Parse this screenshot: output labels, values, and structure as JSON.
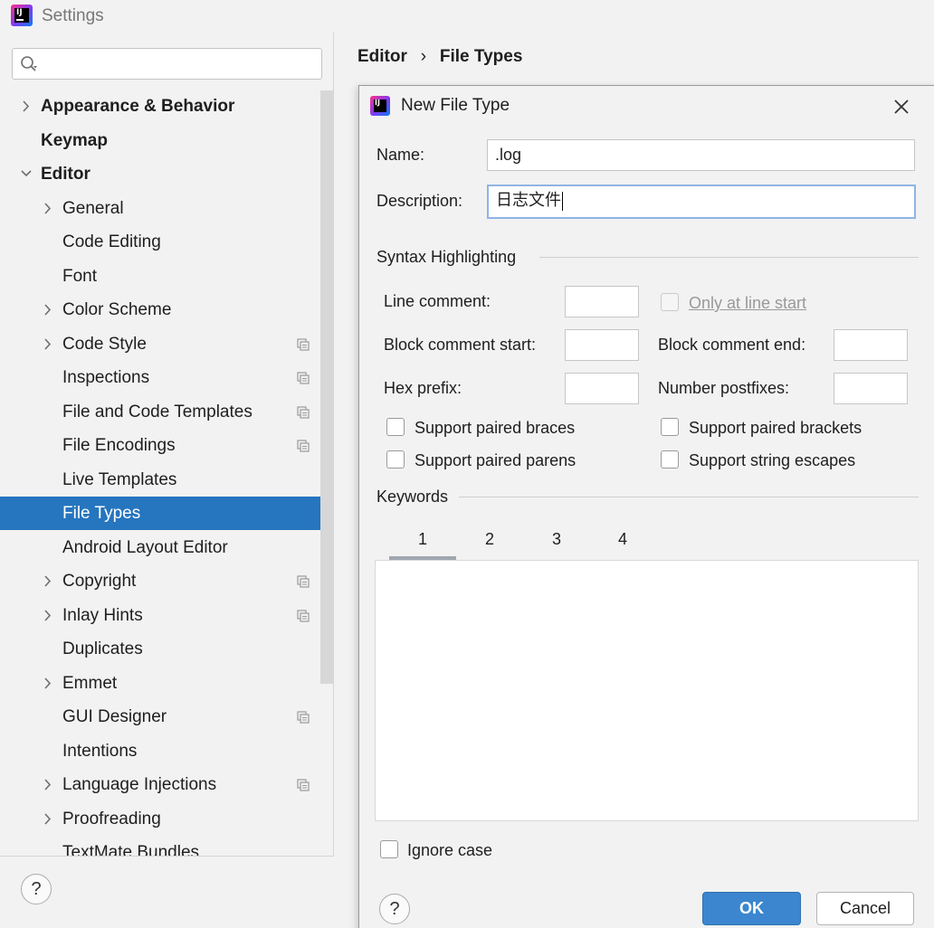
{
  "window": {
    "title": "Settings"
  },
  "search": {
    "placeholder": "",
    "value": ""
  },
  "tree": [
    {
      "label": "Appearance & Behavior",
      "level": 0,
      "bold": true,
      "arrow": "collapsed",
      "project": false
    },
    {
      "label": "Keymap",
      "level": 0,
      "bold": true,
      "arrow": "none",
      "project": false
    },
    {
      "label": "Editor",
      "level": 0,
      "bold": true,
      "arrow": "expanded",
      "project": false
    },
    {
      "label": "General",
      "level": 1,
      "bold": false,
      "arrow": "collapsed",
      "project": false
    },
    {
      "label": "Code Editing",
      "level": 1,
      "bold": false,
      "arrow": "none",
      "project": false
    },
    {
      "label": "Font",
      "level": 1,
      "bold": false,
      "arrow": "none",
      "project": false
    },
    {
      "label": "Color Scheme",
      "level": 1,
      "bold": false,
      "arrow": "collapsed",
      "project": false
    },
    {
      "label": "Code Style",
      "level": 1,
      "bold": false,
      "arrow": "collapsed",
      "project": true
    },
    {
      "label": "Inspections",
      "level": 1,
      "bold": false,
      "arrow": "none",
      "project": true
    },
    {
      "label": "File and Code Templates",
      "level": 1,
      "bold": false,
      "arrow": "none",
      "project": true
    },
    {
      "label": "File Encodings",
      "level": 1,
      "bold": false,
      "arrow": "none",
      "project": true
    },
    {
      "label": "Live Templates",
      "level": 1,
      "bold": false,
      "arrow": "none",
      "project": false
    },
    {
      "label": "File Types",
      "level": 1,
      "bold": false,
      "arrow": "none",
      "project": false,
      "selected": true
    },
    {
      "label": "Android Layout Editor",
      "level": 1,
      "bold": false,
      "arrow": "none",
      "project": false
    },
    {
      "label": "Copyright",
      "level": 1,
      "bold": false,
      "arrow": "collapsed",
      "project": true
    },
    {
      "label": "Inlay Hints",
      "level": 1,
      "bold": false,
      "arrow": "collapsed",
      "project": true
    },
    {
      "label": "Duplicates",
      "level": 1,
      "bold": false,
      "arrow": "none",
      "project": false
    },
    {
      "label": "Emmet",
      "level": 1,
      "bold": false,
      "arrow": "collapsed",
      "project": false
    },
    {
      "label": "GUI Designer",
      "level": 1,
      "bold": false,
      "arrow": "none",
      "project": true
    },
    {
      "label": "Intentions",
      "level": 1,
      "bold": false,
      "arrow": "none",
      "project": false
    },
    {
      "label": "Language Injections",
      "level": 1,
      "bold": false,
      "arrow": "collapsed",
      "project": true
    },
    {
      "label": "Proofreading",
      "level": 1,
      "bold": false,
      "arrow": "collapsed",
      "project": false
    },
    {
      "label": "TextMate Bundles",
      "level": 1,
      "bold": false,
      "arrow": "none",
      "project": false
    }
  ],
  "breadcrumb": {
    "parent": "Editor",
    "separator": "›",
    "current": "File Types"
  },
  "help": {
    "label": "?"
  },
  "dialog": {
    "title": "New File Type",
    "name_label": "Name:",
    "name_value": ".log",
    "description_label": "Description:",
    "description_value": "日志文件",
    "syntax_group": "Syntax Highlighting",
    "line_comment_label": "Line comment:",
    "only_at_line_start": "Only at line start",
    "block_comment_start_label": "Block comment start:",
    "block_comment_end_label": "Block comment end:",
    "hex_prefix_label": "Hex prefix:",
    "number_postfixes_label": "Number postfixes:",
    "support_paired_braces": "Support paired braces",
    "support_paired_brackets": "Support paired brackets",
    "support_paired_parens": "Support paired parens",
    "support_string_escapes": "Support string escapes",
    "keywords_group": "Keywords",
    "tabs": [
      "1",
      "2",
      "3",
      "4"
    ],
    "ignore_case": "Ignore case",
    "ok": "OK",
    "cancel": "Cancel"
  },
  "colors": {
    "selection": "#2675bf",
    "ok_button": "#3b86ce",
    "focus_border": "#8fb5e4"
  }
}
